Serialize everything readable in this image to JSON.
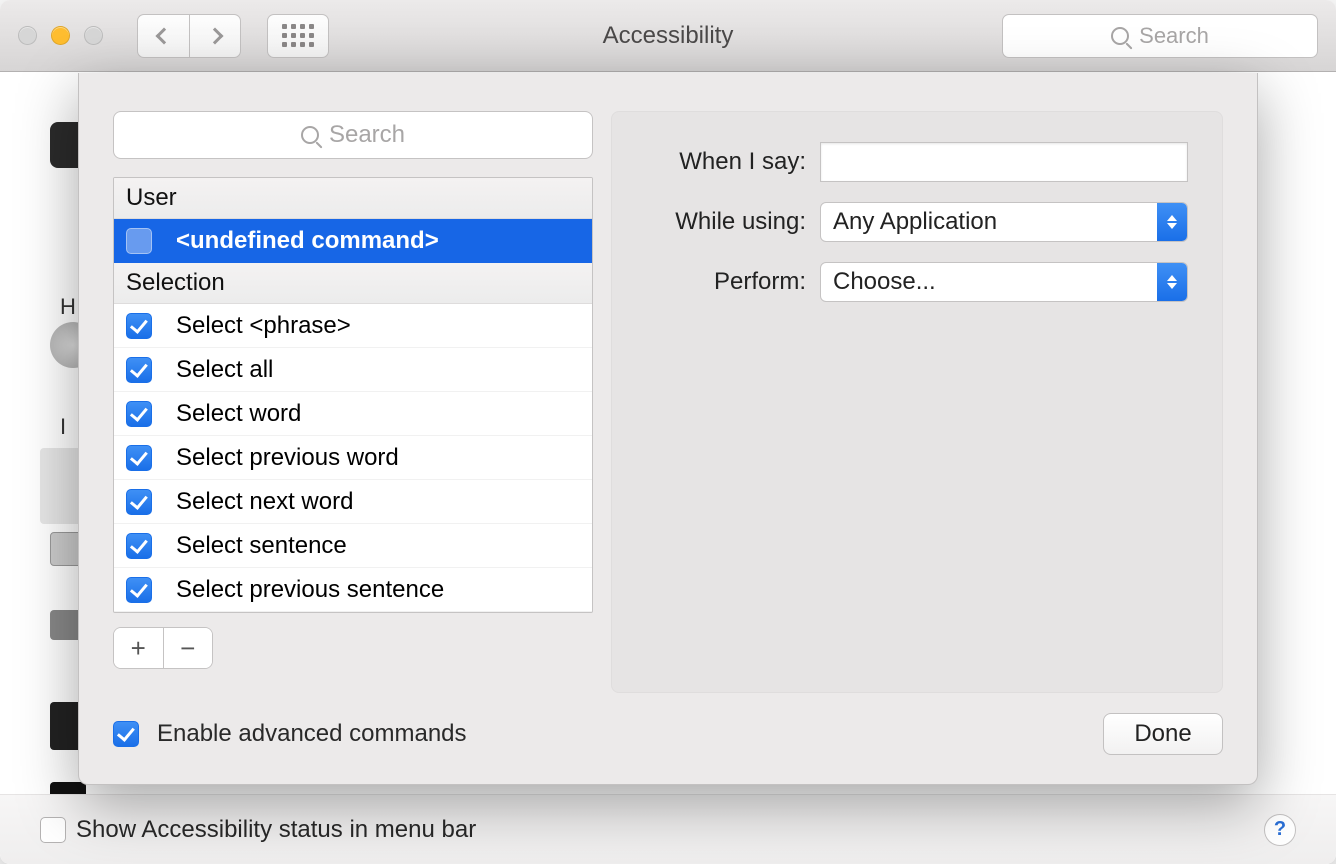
{
  "toolbar": {
    "title": "Accessibility",
    "search_placeholder": "Search"
  },
  "sheet": {
    "search_placeholder": "Search",
    "groups": [
      {
        "name": "User",
        "items": [
          {
            "label": "<undefined command>",
            "checked": false,
            "selected": true
          }
        ]
      },
      {
        "name": "Selection",
        "items": [
          {
            "label": "Select <phrase>",
            "checked": true,
            "selected": false
          },
          {
            "label": "Select all",
            "checked": true,
            "selected": false
          },
          {
            "label": "Select word",
            "checked": true,
            "selected": false
          },
          {
            "label": "Select previous word",
            "checked": true,
            "selected": false
          },
          {
            "label": "Select next word",
            "checked": true,
            "selected": false
          },
          {
            "label": "Select sentence",
            "checked": true,
            "selected": false
          },
          {
            "label": "Select previous sentence",
            "checked": true,
            "selected": false
          }
        ]
      }
    ],
    "form": {
      "when_label": "When I say:",
      "when_value": "",
      "while_label": "While using:",
      "while_value": "Any Application",
      "perform_label": "Perform:",
      "perform_value": "Choose..."
    },
    "add_label": "+",
    "remove_label": "−",
    "enable_advanced_label": "Enable advanced commands",
    "enable_advanced_checked": true,
    "done_label": "Done"
  },
  "bottom": {
    "show_status_label": "Show Accessibility status in menu bar",
    "show_status_checked": false,
    "help_label": "?"
  },
  "bg_hints": {
    "h": "H",
    "i": "I"
  }
}
